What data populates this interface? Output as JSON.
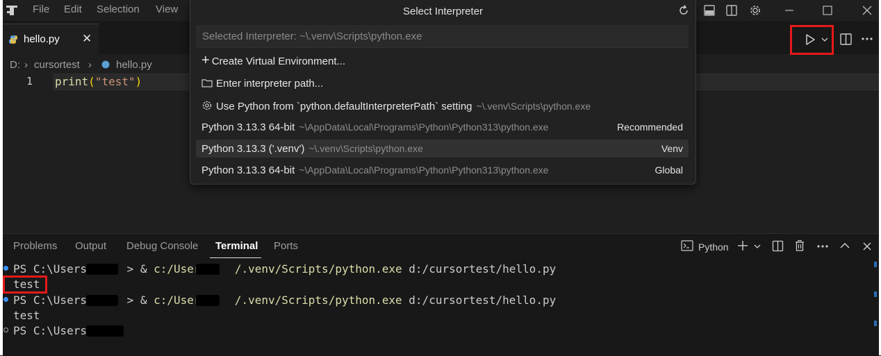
{
  "menu": {
    "file": "File",
    "edit": "Edit",
    "selection": "Selection",
    "view": "View"
  },
  "icons": {
    "app": "vscode-logo-icon",
    "refresh": "refresh-icon",
    "layout": "layout-icon",
    "split": "split-icon",
    "settings": "gear-icon",
    "minimize": "minimize-icon",
    "maximize": "maximize-icon",
    "close": "close-icon",
    "run": "play-icon",
    "python": "python-icon"
  },
  "tab": {
    "label": "hello.py",
    "close": "✕"
  },
  "breadcrumb": {
    "drive": "D:",
    "folder": "cursortest",
    "file": "hello.py"
  },
  "editor": {
    "line_number": "1",
    "code_fn": "print",
    "code_open": "(",
    "code_str": "\"test\"",
    "code_close": ")"
  },
  "quickpick": {
    "title": "Select Interpreter",
    "placeholder": "Selected Interpreter: ~\\.venv\\Scripts\\python.exe",
    "items": [
      {
        "label": "Create Virtual Environment...",
        "desc": "",
        "right": ""
      },
      {
        "label": "Enter interpreter path...",
        "desc": "",
        "right": ""
      },
      {
        "label": "Use Python from `python.defaultInterpreterPath` setting",
        "desc": "~\\.venv\\Scripts\\python.exe",
        "right": ""
      },
      {
        "label": "Python 3.13.3 64-bit",
        "desc": "~\\AppData\\Local\\Programs\\Python\\Python313\\python.exe",
        "right": "Recommended"
      },
      {
        "label": "Python 3.13.3 ('.venv')",
        "desc": "~\\.venv\\Scripts\\python.exe",
        "right": "Venv"
      },
      {
        "label": "Python 3.13.3 64-bit",
        "desc": "~\\AppData\\Local\\Programs\\Python\\Python313\\python.exe",
        "right": "Global"
      }
    ]
  },
  "panel": {
    "tabs": [
      "Problems",
      "Output",
      "Debug Console",
      "Terminal",
      "Ports"
    ],
    "terminal_name": "Python"
  },
  "terminal": {
    "l1_prompt": "PS C:\\Users\\",
    "l1_rest_a": "> & ",
    "l1_path_a": "c:/Users/",
    "l1_path_b": "/.venv/Scripts/python.exe",
    "l1_arg": " d:/cursortest/hello.py",
    "l2": "test",
    "l5_prompt": "PS C:\\Users\\"
  },
  "colors": {
    "accent": "#0078d4",
    "highlight": "#e51919",
    "string": "#ce9178",
    "function": "#dcdcaa"
  }
}
